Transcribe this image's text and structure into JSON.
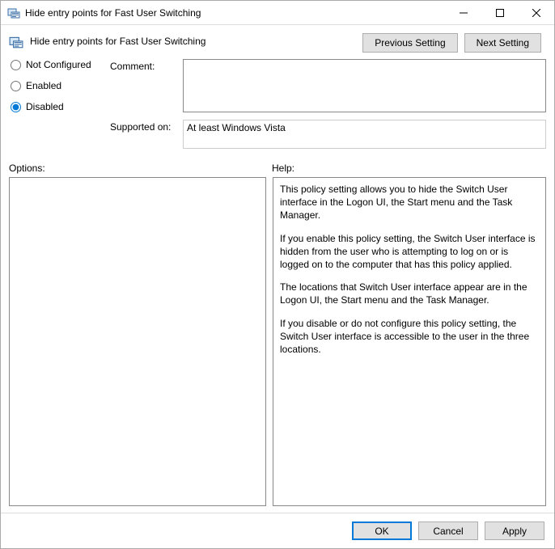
{
  "window": {
    "title": "Hide entry points for Fast User Switching"
  },
  "header": {
    "title": "Hide entry points for Fast User Switching",
    "prev_label": "Previous Setting",
    "next_label": "Next Setting"
  },
  "state": {
    "options": {
      "not_configured": "Not Configured",
      "enabled": "Enabled",
      "disabled": "Disabled"
    },
    "selected": "disabled"
  },
  "comment": {
    "label": "Comment:",
    "value": ""
  },
  "supported": {
    "label": "Supported on:",
    "value": "At least Windows Vista"
  },
  "panes": {
    "options_label": "Options:",
    "help_label": "Help:"
  },
  "help": {
    "p1": "This policy setting allows you to hide the Switch User interface in the Logon UI, the Start menu and the Task Manager.",
    "p2": "If you enable this policy setting, the Switch User interface is hidden from the user who is attempting to log on or is logged on to the computer that has this policy applied.",
    "p3": "The locations that Switch User interface appear are in the Logon UI, the Start menu and the Task Manager.",
    "p4": "If you disable or do not configure this policy setting, the Switch User interface is accessible to the user in the three locations."
  },
  "footer": {
    "ok": "OK",
    "cancel": "Cancel",
    "apply": "Apply"
  }
}
